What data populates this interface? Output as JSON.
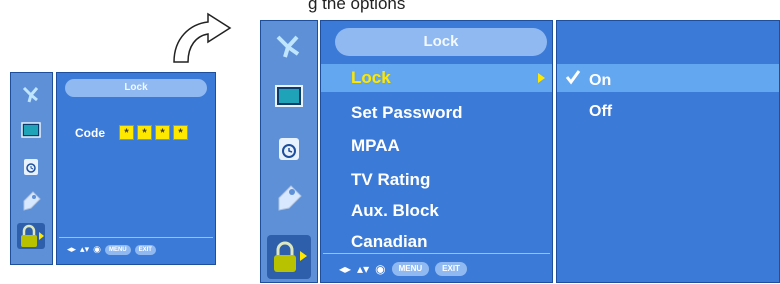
{
  "caption": "g the options",
  "small_screen": {
    "title": "Lock",
    "code_label": "Code",
    "code_digits": [
      "*",
      "*",
      "*",
      "*"
    ],
    "footer_keys": [
      "◂▸",
      "▴▾",
      "◉"
    ],
    "footer_buttons": [
      "MENU",
      "EXIT"
    ]
  },
  "large_screen": {
    "title": "Lock",
    "menu_items": [
      "Lock",
      "Set Password",
      "MPAA",
      "TV Rating",
      "Aux. Block",
      "Canadian"
    ],
    "selected_index": 0,
    "submenu": {
      "options": [
        "On",
        "Off"
      ],
      "checked": "On"
    },
    "footer_keys": [
      "◂▸",
      "▴▾",
      "◉"
    ],
    "footer_buttons": [
      "MENU",
      "EXIT"
    ]
  },
  "colors": {
    "menu_bg": "#3c7ad8",
    "side_bg": "#5e90d8",
    "highlight": "#63a7f0",
    "selected_text": "#ffe800",
    "title_pill": "#8fb9f0"
  },
  "icons": [
    "satellite-dish-icon",
    "screen-icon",
    "clock-icon",
    "tag-icon",
    "padlock-icon"
  ]
}
